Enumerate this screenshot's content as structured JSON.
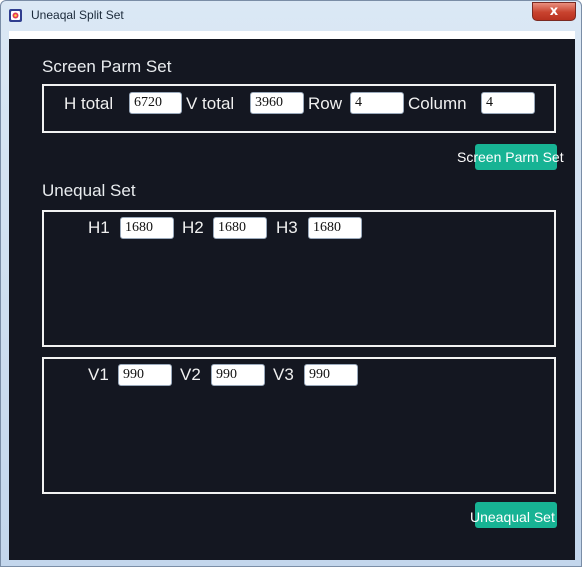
{
  "window": {
    "title": "Uneaqal Split Set",
    "close_label": "x"
  },
  "screen_parm": {
    "section_title": "Screen Parm Set",
    "h_total_label": "H total",
    "h_total_value": "6720",
    "v_total_label": "V total",
    "v_total_value": "3960",
    "row_label": "Row",
    "row_value": "4",
    "column_label": "Column",
    "column_value": "4",
    "button_label": "Screen Parm Set"
  },
  "unequal": {
    "section_title": "Unequal Set",
    "h": [
      {
        "label": "H1",
        "value": "1680"
      },
      {
        "label": "H2",
        "value": "1680"
      },
      {
        "label": "H3",
        "value": "1680"
      }
    ],
    "v": [
      {
        "label": "V1",
        "value": "990"
      },
      {
        "label": "V2",
        "value": "990"
      },
      {
        "label": "V3",
        "value": "990"
      }
    ],
    "button_label": "Uneaqual Set"
  },
  "colors": {
    "background": "#141721",
    "button": "#17b394",
    "border": "#f2f2f2"
  }
}
